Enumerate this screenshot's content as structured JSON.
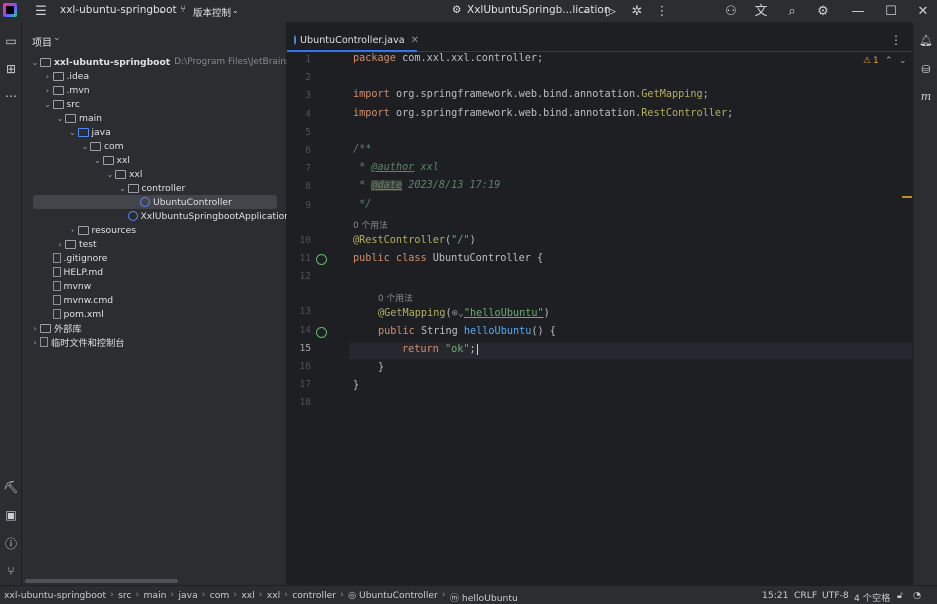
{
  "window": {
    "project_name": "xxl-ubuntu-springboot",
    "vcs_label": "版本控制",
    "run_config": "XxlUbuntuSpringb...lication"
  },
  "project_panel": {
    "title": "项目",
    "tree": [
      {
        "label": "xxl-ubuntu-springboot",
        "path": "D:\\Program Files\\JetBrains\\java_",
        "depth": 0,
        "arrow": "⌄",
        "icon": "folder"
      },
      {
        "label": ".idea",
        "depth": 1,
        "arrow": "›",
        "icon": "folder"
      },
      {
        "label": ".mvn",
        "depth": 1,
        "arrow": "›",
        "icon": "folder"
      },
      {
        "label": "src",
        "depth": 1,
        "arrow": "⌄",
        "icon": "folder"
      },
      {
        "label": "main",
        "depth": 2,
        "arrow": "⌄",
        "icon": "folder"
      },
      {
        "label": "java",
        "depth": 3,
        "arrow": "⌄",
        "icon": "folder-blue"
      },
      {
        "label": "com",
        "depth": 4,
        "arrow": "⌄",
        "icon": "folder"
      },
      {
        "label": "xxl",
        "depth": 5,
        "arrow": "⌄",
        "icon": "folder"
      },
      {
        "label": "xxl",
        "depth": 6,
        "arrow": "⌄",
        "icon": "folder"
      },
      {
        "label": "controller",
        "depth": 7,
        "arrow": "⌄",
        "icon": "folder"
      },
      {
        "label": "UbuntuController",
        "depth": 8,
        "arrow": "",
        "icon": "class"
      },
      {
        "label": "XxlUbuntuSpringbootApplication",
        "depth": 7,
        "arrow": "",
        "icon": "class"
      },
      {
        "label": "resources",
        "depth": 3,
        "arrow": "›",
        "icon": "folder"
      },
      {
        "label": "test",
        "depth": 2,
        "arrow": "›",
        "icon": "folder"
      },
      {
        "label": ".gitignore",
        "depth": 1,
        "arrow": "",
        "icon": "file"
      },
      {
        "label": "HELP.md",
        "depth": 1,
        "arrow": "",
        "icon": "file"
      },
      {
        "label": "mvnw",
        "depth": 1,
        "arrow": "",
        "icon": "file"
      },
      {
        "label": "mvnw.cmd",
        "depth": 1,
        "arrow": "",
        "icon": "file"
      },
      {
        "label": "pom.xml",
        "depth": 1,
        "arrow": "",
        "icon": "file"
      },
      {
        "label": "外部库",
        "depth": 0,
        "arrow": "›",
        "icon": "folder"
      },
      {
        "label": "临时文件和控制台",
        "depth": 0,
        "arrow": "›",
        "icon": "file"
      }
    ]
  },
  "editor": {
    "tab_label": "UbuntuController.java",
    "warning_count": "1",
    "usage_hint_1": "0 个用法",
    "usage_hint_2": "0 个用法",
    "line_numbers": [
      "1",
      "2",
      "3",
      "4",
      "5",
      "6",
      "7",
      "8",
      "9",
      "10",
      "11",
      "12",
      "13",
      "14",
      "15",
      "16",
      "17",
      "18"
    ],
    "code": {
      "l1_kw": "package",
      "l1_rest": " com.xxl.xxl.controller;",
      "l3_kw": "import",
      "l3_rest": " org.springframework.web.bind.annotation.",
      "l3_cls": "GetMapping",
      "l3_end": ";",
      "l4_kw": "import",
      "l4_rest": " org.springframework.web.bind.annotation.",
      "l4_cls": "RestController",
      "l4_end": ";",
      "l6": "/**",
      "l7_pre": " * ",
      "l7_tag": "@author",
      "l7_val": " xxl",
      "l8_pre": " * ",
      "l8_tag": "@date",
      "l8_val": " 2023/8/13 17:19",
      "l9": " */",
      "l10_ann": "@RestController",
      "l10_p1": "(",
      "l10_str": "\"/\"",
      "l10_p2": ")",
      "l11_kw": "public class",
      "l11_rest": " UbuntuController {",
      "l13_ann": "@GetMapping",
      "l13_p1": "(",
      "l13_globe": "⊕⌄",
      "l13_str": "\"helloUbuntu\"",
      "l13_p2": ")",
      "l14_kw": "public",
      "l14_type": " String ",
      "l14_fn": "helloUbuntu",
      "l14_rest": "() {",
      "l15_kw": "return",
      "l15_str": " \"ok\"",
      "l15_end": ";",
      "l16": "}",
      "l17": "}"
    }
  },
  "statusbar": {
    "crumbs": [
      "xxl-ubuntu-springboot",
      "src",
      "main",
      "java",
      "com",
      "xxl",
      "xxl",
      "controller",
      "UbuntuController",
      "helloUbuntu"
    ],
    "position": "15:21",
    "line_sep": "CRLF",
    "encoding": "UTF-8",
    "indent": "4 个空格"
  }
}
